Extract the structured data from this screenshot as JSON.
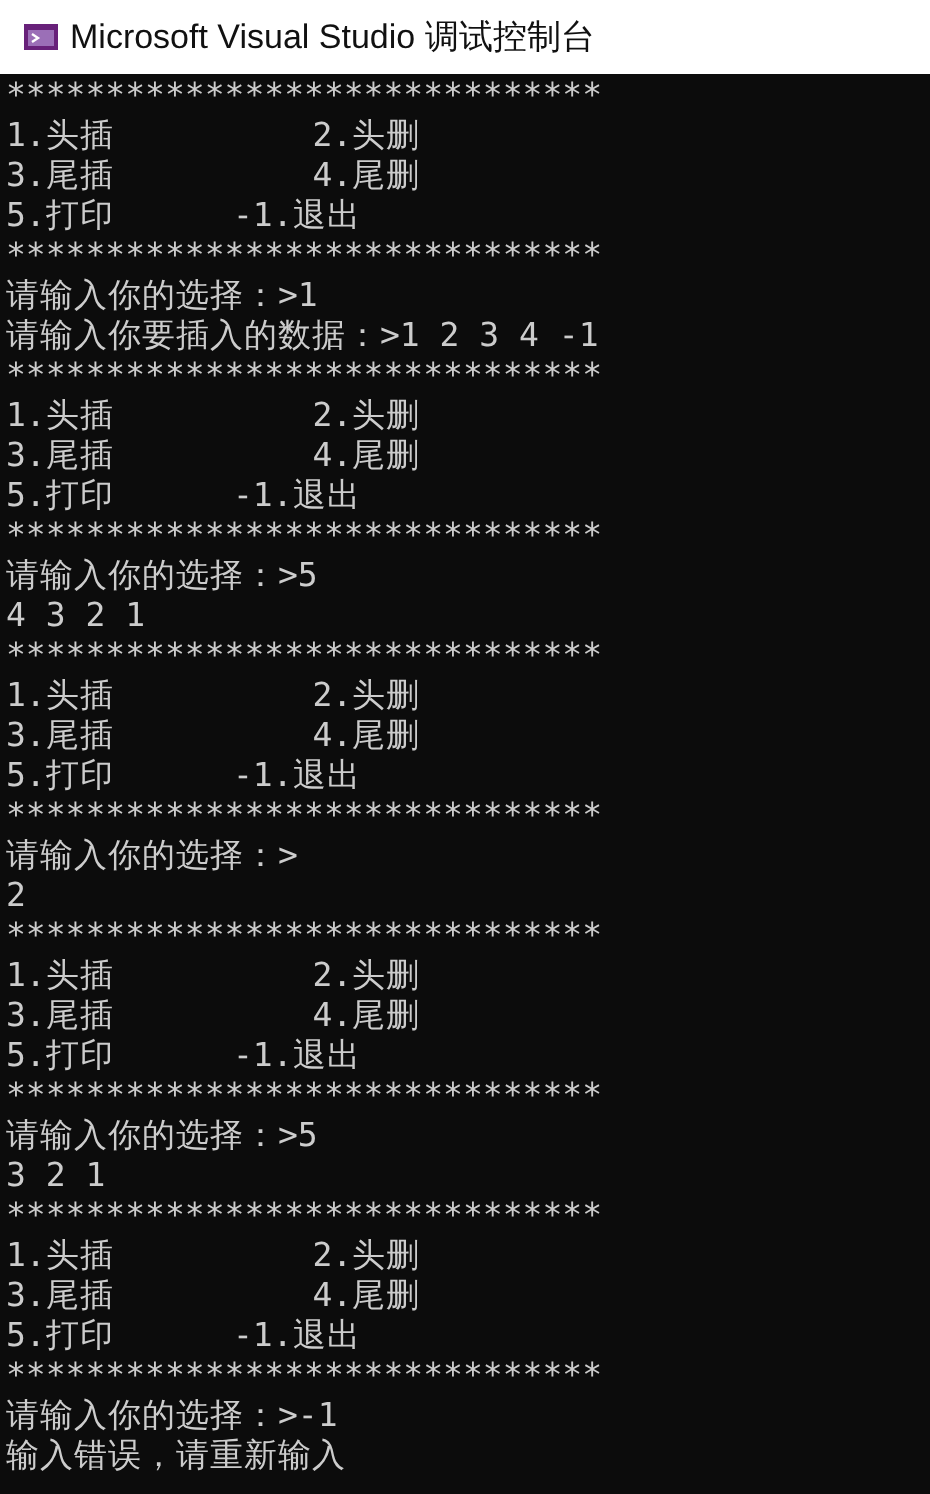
{
  "window": {
    "title": "Microsoft Visual Studio 调试控制台"
  },
  "console": {
    "lines": [
      "******************************",
      "1.头插          2.头删",
      "3.尾插          4.尾删",
      "5.打印      -1.退出",
      "******************************",
      "请输入你的选择：>1",
      "请输入你要插入的数据：>1 2 3 4 -1",
      "******************************",
      "1.头插          2.头删",
      "3.尾插          4.尾删",
      "5.打印      -1.退出",
      "******************************",
      "请输入你的选择：>5",
      "4 3 2 1",
      "******************************",
      "1.头插          2.头删",
      "3.尾插          4.尾删",
      "5.打印      -1.退出",
      "******************************",
      "请输入你的选择：>",
      "2",
      "******************************",
      "1.头插          2.头删",
      "3.尾插          4.尾删",
      "5.打印      -1.退出",
      "******************************",
      "请输入你的选择：>5",
      "3 2 1",
      "******************************",
      "1.头插          2.头删",
      "3.尾插          4.尾删",
      "5.打印      -1.退出",
      "******************************",
      "请输入你的选择：>-1",
      "输入错误，请重新输入"
    ]
  }
}
